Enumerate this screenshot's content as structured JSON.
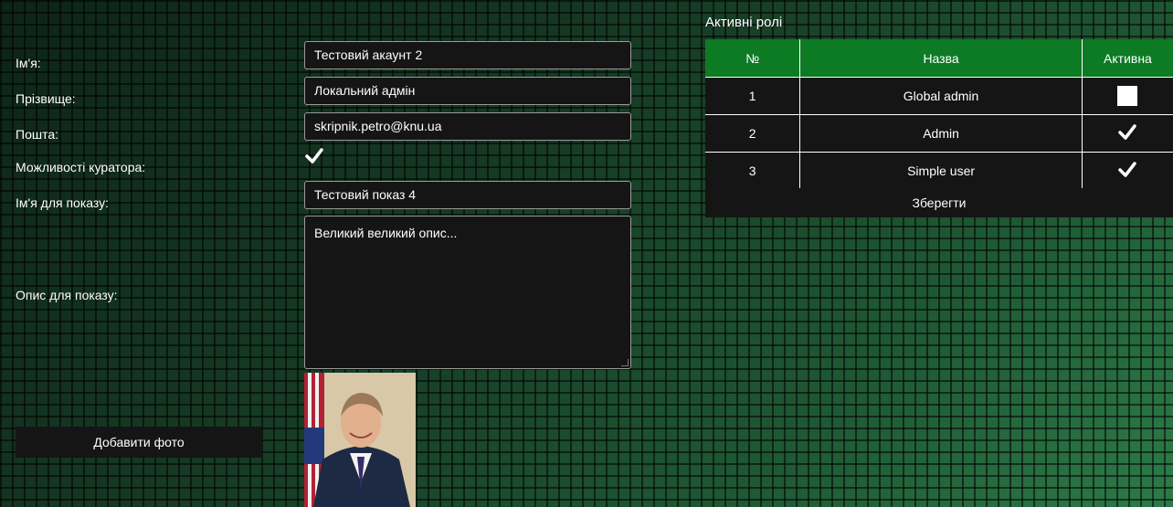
{
  "form": {
    "name_label": "Ім'я:",
    "name_value": "Тестовий акаунт 2",
    "surname_label": "Прізвище:",
    "surname_value": "Локальний адмін",
    "email_label": "Пошта:",
    "email_value": "skripnik.petro@knu.ua",
    "curator_label": "Можливості куратора:",
    "curator_checked": true,
    "display_name_label": "Ім'я для показу:",
    "display_name_value": "Тестовий показ 4",
    "description_label": "Опис для показу:",
    "description_value": "Великий великий опис...",
    "add_photo_label": "Добавити фото"
  },
  "roles": {
    "title": "Активні ролі",
    "columns": [
      "№",
      "Назва",
      "Активна"
    ],
    "rows": [
      {
        "num": "1",
        "name": "Global admin",
        "active": false
      },
      {
        "num": "2",
        "name": "Admin",
        "active": true
      },
      {
        "num": "3",
        "name": "Simple user",
        "active": true
      }
    ],
    "save_label": "Зберегти"
  },
  "colors": {
    "header_green": "#0d7a24",
    "panel_dark": "#151515"
  }
}
